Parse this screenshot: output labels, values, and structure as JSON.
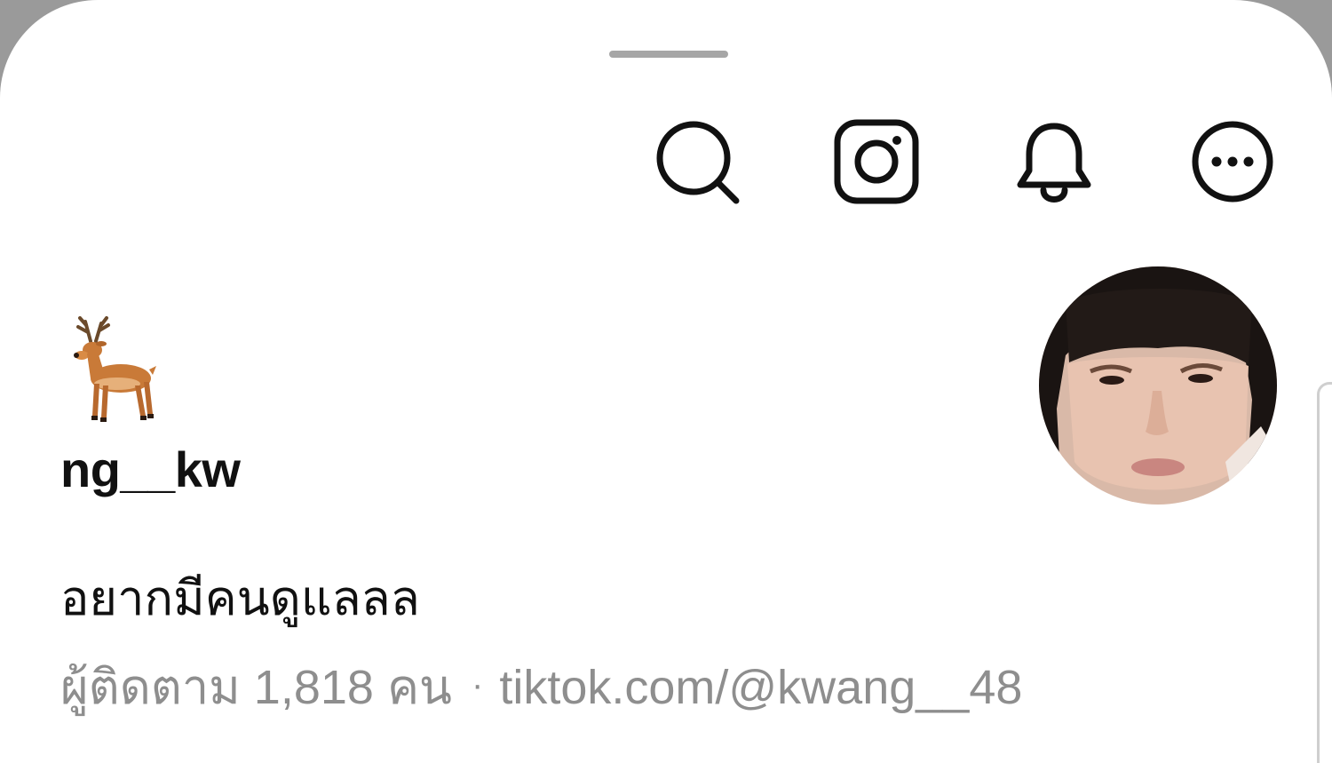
{
  "profile": {
    "emoji": "🦌",
    "username": "ng__kw",
    "bio": "อยากมีคนดูแลลล",
    "followers_prefix": "ผู้ติดตาม",
    "followers_count": "1,818",
    "followers_suffix": "คน",
    "separator": "·",
    "link": "tiktok.com/@kwang__48"
  },
  "toolbar": {
    "icons": [
      "search-icon",
      "instagram-icon",
      "bell-icon",
      "more-icon"
    ]
  },
  "colors": {
    "text_primary": "#111111",
    "text_secondary": "#8e8e8e",
    "background": "#ffffff",
    "grabber": "#a6a6a6"
  }
}
